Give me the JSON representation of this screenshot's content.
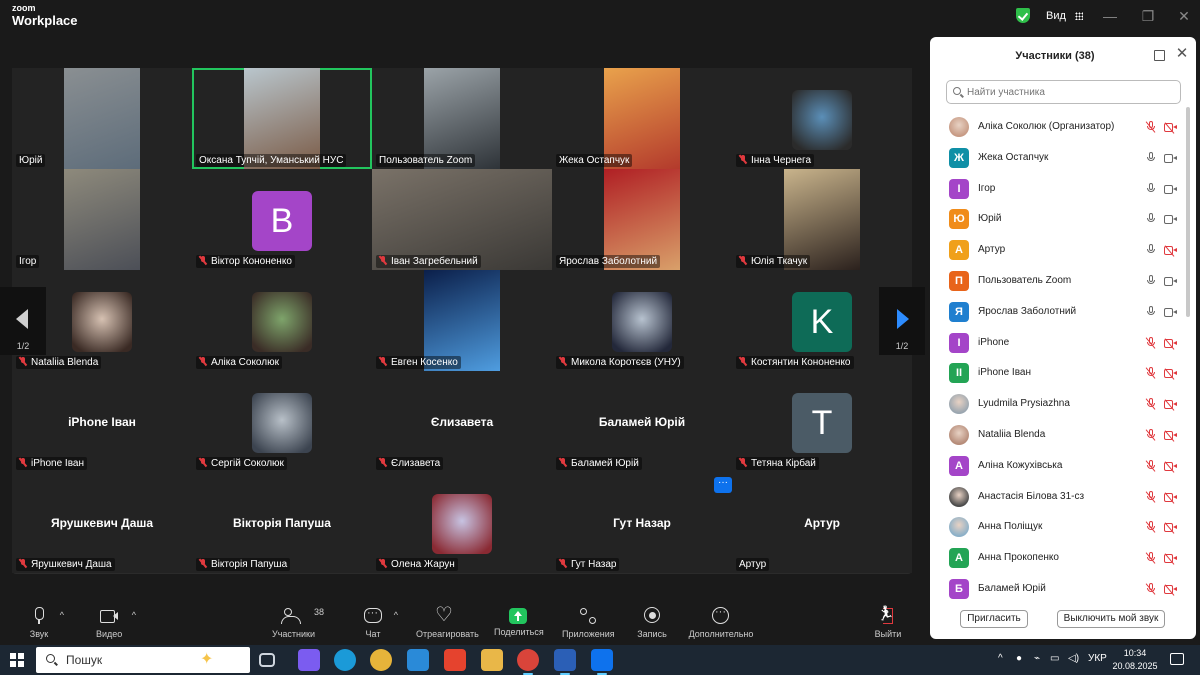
{
  "app": {
    "brand_top": "zoom",
    "brand_bottom": "Workplace",
    "view_label": "Вид"
  },
  "gallery": {
    "page_indicator": "1/2",
    "tiles": [
      {
        "name": "Юрій",
        "kind": "video",
        "muted": false,
        "colors": [
          "#8a8f92",
          "#5d6c7a"
        ]
      },
      {
        "name": "Оксана Тупчій, Уманський НУС",
        "kind": "video",
        "muted": false,
        "active": true,
        "colors": [
          "#b9c6cd",
          "#7a5a45"
        ]
      },
      {
        "name": "Пользователь Zoom",
        "kind": "video",
        "muted": false,
        "colors": [
          "#9ba3a8",
          "#2e3338"
        ]
      },
      {
        "name": "Жека Остапчук",
        "kind": "video",
        "muted": false,
        "colors": [
          "#e9a24c",
          "#b33a2c"
        ]
      },
      {
        "name": "Інна Чернега",
        "kind": "photo",
        "muted": true,
        "colors": [
          "#5b8fb8",
          "#2b2b2b"
        ]
      },
      {
        "name": "Ігор",
        "kind": "video",
        "muted": false,
        "colors": [
          "#8e8a7c",
          "#4c4f57"
        ]
      },
      {
        "name": "Віктор Кононенко",
        "kind": "avatar",
        "letter": "В",
        "muted": true,
        "color": "#a445c8"
      },
      {
        "name": "Іван Загребельний",
        "kind": "wide",
        "muted": true,
        "colors": [
          "#7a7268",
          "#3a3835"
        ]
      },
      {
        "name": "Ярослав Заболотний",
        "kind": "video",
        "muted": false,
        "colors": [
          "#b01f24",
          "#d9a06a"
        ]
      },
      {
        "name": "Юлія Ткачук",
        "kind": "video",
        "muted": true,
        "colors": [
          "#c9b48c",
          "#2b211d"
        ]
      },
      {
        "name": "Nataliia Blenda",
        "kind": "photo",
        "muted": true,
        "colors": [
          "#d6c1b2",
          "#3a2a24"
        ]
      },
      {
        "name": "Аліка Соколюк",
        "kind": "photo",
        "muted": true,
        "colors": [
          "#7ea46b",
          "#3a2c26"
        ]
      },
      {
        "name": "Евген Косенко",
        "kind": "video",
        "muted": true,
        "colors": [
          "#0b1f4a",
          "#4f9de0"
        ]
      },
      {
        "name": "Микола Коротєєв (УНУ)",
        "kind": "photo",
        "muted": true,
        "colors": [
          "#b7c2cf",
          "#23283a"
        ]
      },
      {
        "name": "Костянтин Кононенко",
        "kind": "avatar",
        "letter": "K",
        "muted": true,
        "color": "#0e6b57"
      },
      {
        "name": "iPhone Іван",
        "kind": "text",
        "display": "iPhone Іван",
        "muted": true
      },
      {
        "name": "Сергій Соколюк",
        "kind": "photo",
        "muted": true,
        "colors": [
          "#b8c0c8",
          "#3c4450"
        ]
      },
      {
        "name": "Єлизавета",
        "kind": "text",
        "display": "Єлизавета",
        "muted": true
      },
      {
        "name": "Баламей Юрій",
        "kind": "text",
        "display": "Баламей Юрій",
        "muted": true
      },
      {
        "name": "Тетяна Кірбай",
        "kind": "avatar",
        "letter": "T",
        "muted": true,
        "color": "#4b5b66"
      },
      {
        "name": "Ярушкевич Даша",
        "kind": "text",
        "display": "Ярушкевич Даша",
        "muted": true
      },
      {
        "name": "Вікторія Папуша",
        "kind": "text",
        "display": "Вікторія Папуша",
        "muted": true
      },
      {
        "name": "Олена Жарун",
        "kind": "photo",
        "muted": true,
        "colors": [
          "#c7c3e2",
          "#8a2a33"
        ]
      },
      {
        "name": "Гут Назар",
        "kind": "text",
        "display": "Гут Назар",
        "muted": true
      },
      {
        "name": "Артур",
        "kind": "text",
        "display": "Артур",
        "muted": false
      }
    ]
  },
  "panel": {
    "title": "Участники (38)",
    "search_placeholder": "Найти участника",
    "invite_label": "Пригласить",
    "mute_me_label": "Выключить мой звук",
    "participants": [
      {
        "name": "Аліка Соколюк (Организатор)",
        "avatar": "photo",
        "color": "#c79a84",
        "mic": "off",
        "cam": "off"
      },
      {
        "name": "Жека Остапчук",
        "avatar": "Ж",
        "color": "#0f8fa6",
        "mic": "on",
        "cam": "on"
      },
      {
        "name": "Ігор",
        "avatar": "І",
        "color": "#a445c8",
        "mic": "on",
        "cam": "on"
      },
      {
        "name": "Юрій",
        "avatar": "Ю",
        "color": "#f08c1a",
        "mic": "on",
        "cam": "on"
      },
      {
        "name": "Артур",
        "avatar": "А",
        "color": "#f0a01a",
        "mic": "on",
        "cam": "off"
      },
      {
        "name": "Пользователь Zoom",
        "avatar": "П",
        "color": "#e8641a",
        "mic": "on",
        "cam": "on"
      },
      {
        "name": "Ярослав Заболотний",
        "avatar": "Я",
        "color": "#1f7fcf",
        "mic": "on",
        "cam": "on"
      },
      {
        "name": "iPhone",
        "avatar": "I",
        "color": "#a445c8",
        "mic": "off",
        "cam": "off"
      },
      {
        "name": "iPhone Іван",
        "avatar": "II",
        "color": "#23a455",
        "mic": "off",
        "cam": "off"
      },
      {
        "name": "Lyudmila Prysiazhna",
        "avatar": "photo",
        "color": "#9aa6b0",
        "mic": "off",
        "cam": "off"
      },
      {
        "name": "Nataliia Blenda",
        "avatar": "photo",
        "color": "#b58b78",
        "mic": "off",
        "cam": "off"
      },
      {
        "name": "Аліна Кожухівська",
        "avatar": "А",
        "color": "#a445c8",
        "mic": "off",
        "cam": "off"
      },
      {
        "name": "Анастасія Білова 31-сз",
        "avatar": "photo",
        "color": "#4a4a4a",
        "mic": "off",
        "cam": "off"
      },
      {
        "name": "Анна Поліщук",
        "avatar": "photo",
        "color": "#8bb0c8",
        "mic": "off",
        "cam": "off"
      },
      {
        "name": "Анна Прокопенко",
        "avatar": "А",
        "color": "#23a455",
        "mic": "off",
        "cam": "off"
      },
      {
        "name": "Баламей Юрій",
        "avatar": "Б",
        "color": "#a445c8",
        "mic": "off",
        "cam": "off"
      }
    ]
  },
  "toolbar": {
    "audio_label": "Звук",
    "video_label": "Видео",
    "participants_label": "Участники",
    "participants_count": "38",
    "chat_label": "Чат",
    "react_label": "Отреагировать",
    "share_label": "Поделиться",
    "apps_label": "Приложения",
    "record_label": "Запись",
    "more_label": "Дополнительно",
    "leave_label": "Выйти"
  },
  "taskbar": {
    "search_placeholder": "Пошук",
    "language": "УКР",
    "time": "10:34",
    "date": "20.08.2025",
    "apps": [
      "task-view",
      "copilot",
      "edge",
      "chrome",
      "internet-explorer",
      "office",
      "file-explorer",
      "chrome-profile",
      "word",
      "zoom"
    ]
  }
}
